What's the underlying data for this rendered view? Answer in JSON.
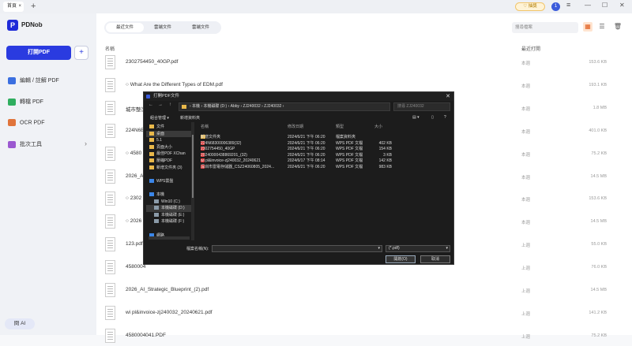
{
  "titlebar": {
    "tab_label": "首頁",
    "tab_plus": "+",
    "upgrade": "♡ 抽獎",
    "user_initial": "1",
    "win_min": "—",
    "win_max": "☐",
    "win_close": "✕"
  },
  "sidebar": {
    "logo_letter": "P",
    "app_name": "PDNob",
    "open_button": "打開PDF",
    "add_button": "+",
    "nav": [
      {
        "label": "編輯 / 註解 PDF",
        "color": "#3b6fe0"
      },
      {
        "label": "轉檔 PDF",
        "color": "#2fae5f"
      },
      {
        "label": "OCR PDF",
        "color": "#e0743b"
      },
      {
        "label": "批次工具",
        "color": "#9b59d0"
      }
    ],
    "nav_chevron": "›",
    "ai_button": "問 AI"
  },
  "main": {
    "tabs": [
      "最近文件",
      "雲端文件",
      "雲端文件"
    ],
    "search_placeholder": "搜尋檔案",
    "header": {
      "name": "名稱",
      "opened": "最近打開"
    },
    "files": [
      {
        "name": "2302754450_40GP.pdf",
        "src": "本週",
        "size": "153.6 KB"
      },
      {
        "name": "○ What Are the Different Types of EDM.pdf",
        "src": "本週",
        "size": "193.1 KB"
      },
      {
        "name": "城市整潔",
        "src": "本週",
        "size": "1.8 MB"
      },
      {
        "name": "224N6B",
        "src": "本週",
        "size": "401.0 KB"
      },
      {
        "name": "○ 4580",
        "src": "本週",
        "size": "75.2 KB"
      },
      {
        "name": "2026_AI",
        "src": "本週",
        "size": "14.5 MB"
      },
      {
        "name": "○ 2302",
        "src": "本週",
        "size": "153.6 KB"
      },
      {
        "name": "○ 2026",
        "src": "本週",
        "size": "14.5 MB"
      },
      {
        "name": "123.pdf",
        "src": "上週",
        "size": "55.0 KB"
      },
      {
        "name": "4580004",
        "src": "上週",
        "size": "76.0 KB"
      },
      {
        "name": "2026_AI_Strategic_Blueprint_(2).pdf",
        "src": "上週",
        "size": "14.5 MB"
      },
      {
        "name": "wi pl&invoice-zj240032_20240621.pdf",
        "src": "上週",
        "size": "141.2 KB"
      },
      {
        "name": "4580004041.PDF",
        "src": "上週",
        "size": "75.2 KB"
      }
    ]
  },
  "dialog": {
    "title": "打開PDF文件",
    "close": "✕",
    "back": "←",
    "forward": "→",
    "up": "↑",
    "address": "› 本機 › 本機磁碟 (D:) › Abby › ZJ240032 › ZJ240032 ›",
    "search_placeholder": "搜尋 ZJ240032",
    "organize": "組合管理 ▾",
    "new_folder": "新增資料夾",
    "tree": [
      {
        "label": "文件",
        "icon": "folder",
        "indent": 0,
        "selected": false
      },
      {
        "label": "桌面",
        "icon": "folder",
        "indent": 0,
        "selected": true
      },
      {
        "label": "5.1",
        "icon": "folder",
        "indent": 0,
        "selected": false
      },
      {
        "label": "頁面大小",
        "icon": "folder",
        "indent": 0,
        "selected": false
      },
      {
        "label": "最佳PDF XChan",
        "icon": "folder",
        "indent": 0,
        "selected": false
      },
      {
        "label": "壓縮PDF",
        "icon": "folder",
        "indent": 0,
        "selected": false
      },
      {
        "label": "新增文件夾 (3)",
        "icon": "folder",
        "indent": 0,
        "selected": false
      },
      {
        "label": "",
        "icon": "none",
        "indent": 0,
        "selected": false
      },
      {
        "label": "WPS雲盤",
        "icon": "blue",
        "indent": 0,
        "selected": false
      },
      {
        "label": "",
        "icon": "none",
        "indent": 0,
        "selected": false
      },
      {
        "label": "本機",
        "icon": "blue",
        "indent": 0,
        "selected": false
      },
      {
        "label": "Win10 (C:)",
        "icon": "drive",
        "indent": 1,
        "selected": false
      },
      {
        "label": "本機磁碟 (D:)",
        "icon": "drive",
        "indent": 1,
        "selected": true
      },
      {
        "label": "本機磁碟 (E:)",
        "icon": "drive",
        "indent": 1,
        "selected": false
      },
      {
        "label": "本機磁碟 (F:)",
        "icon": "drive",
        "indent": 1,
        "selected": false
      },
      {
        "label": "",
        "icon": "none",
        "indent": 0,
        "selected": false
      },
      {
        "label": "網路",
        "icon": "blue",
        "indent": 0,
        "selected": false
      }
    ],
    "columns": {
      "name": "名稱",
      "modified": "修改日期",
      "type": "類型",
      "size": "大小"
    },
    "files": [
      {
        "name": "新增文件夾",
        "date": "2024/6/21 下午 06:20",
        "type": "檔案資料夾",
        "size": "",
        "icon": "folder"
      },
      {
        "name": "224N68300006389(32)",
        "date": "2024/6/21 下午 06:20",
        "type": "WPS PDF 文檔",
        "size": "402 KB",
        "icon": "pdf"
      },
      {
        "name": "2302754450_40GP",
        "date": "2024/6/21 下午 06:20",
        "type": "WPS PDF 文檔",
        "size": "154 KB",
        "icon": "pdf"
      },
      {
        "name": "20240000438869201_(32)",
        "date": "2024/6/21 下午 06:20",
        "type": "WPS PDF 文檔",
        "size": "3 KB",
        "icon": "pdf"
      },
      {
        "name": "wi pl&invoice-zj240032_20240621",
        "date": "2024/6/17 下午 08:14",
        "type": "WPS PDF 文檔",
        "size": "142 KB",
        "icon": "pdf"
      },
      {
        "name": "深圳市雷電存儲器_CSZ24060805_2024...",
        "date": "2024/6/21 下午 06:20",
        "type": "WPS PDF 文檔",
        "size": "983 KB",
        "icon": "pdf"
      }
    ],
    "filename_label": "檔案名稱(N):",
    "filetype": "(*.pdf)",
    "open_btn": "開啟(O)",
    "cancel_btn": "取消"
  }
}
